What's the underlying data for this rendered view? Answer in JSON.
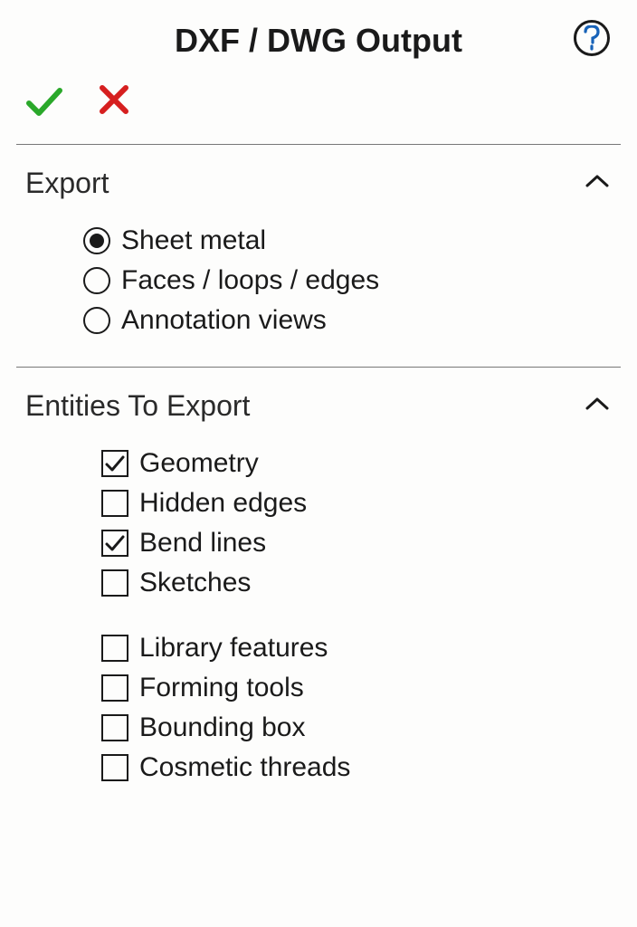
{
  "title": "DXF / DWG Output",
  "sections": {
    "export": {
      "title": "Export",
      "options": [
        {
          "label": "Sheet metal",
          "selected": true
        },
        {
          "label": "Faces / loops / edges",
          "selected": false
        },
        {
          "label": "Annotation views",
          "selected": false
        }
      ]
    },
    "entities": {
      "title": "Entities To Export",
      "group1": [
        {
          "label": "Geometry",
          "checked": true
        },
        {
          "label": "Hidden edges",
          "checked": false
        },
        {
          "label": "Bend lines",
          "checked": true
        },
        {
          "label": "Sketches",
          "checked": false
        }
      ],
      "group2": [
        {
          "label": "Library features",
          "checked": false
        },
        {
          "label": "Forming tools",
          "checked": false
        },
        {
          "label": "Bounding box",
          "checked": false
        },
        {
          "label": "Cosmetic threads",
          "checked": false
        }
      ]
    }
  }
}
